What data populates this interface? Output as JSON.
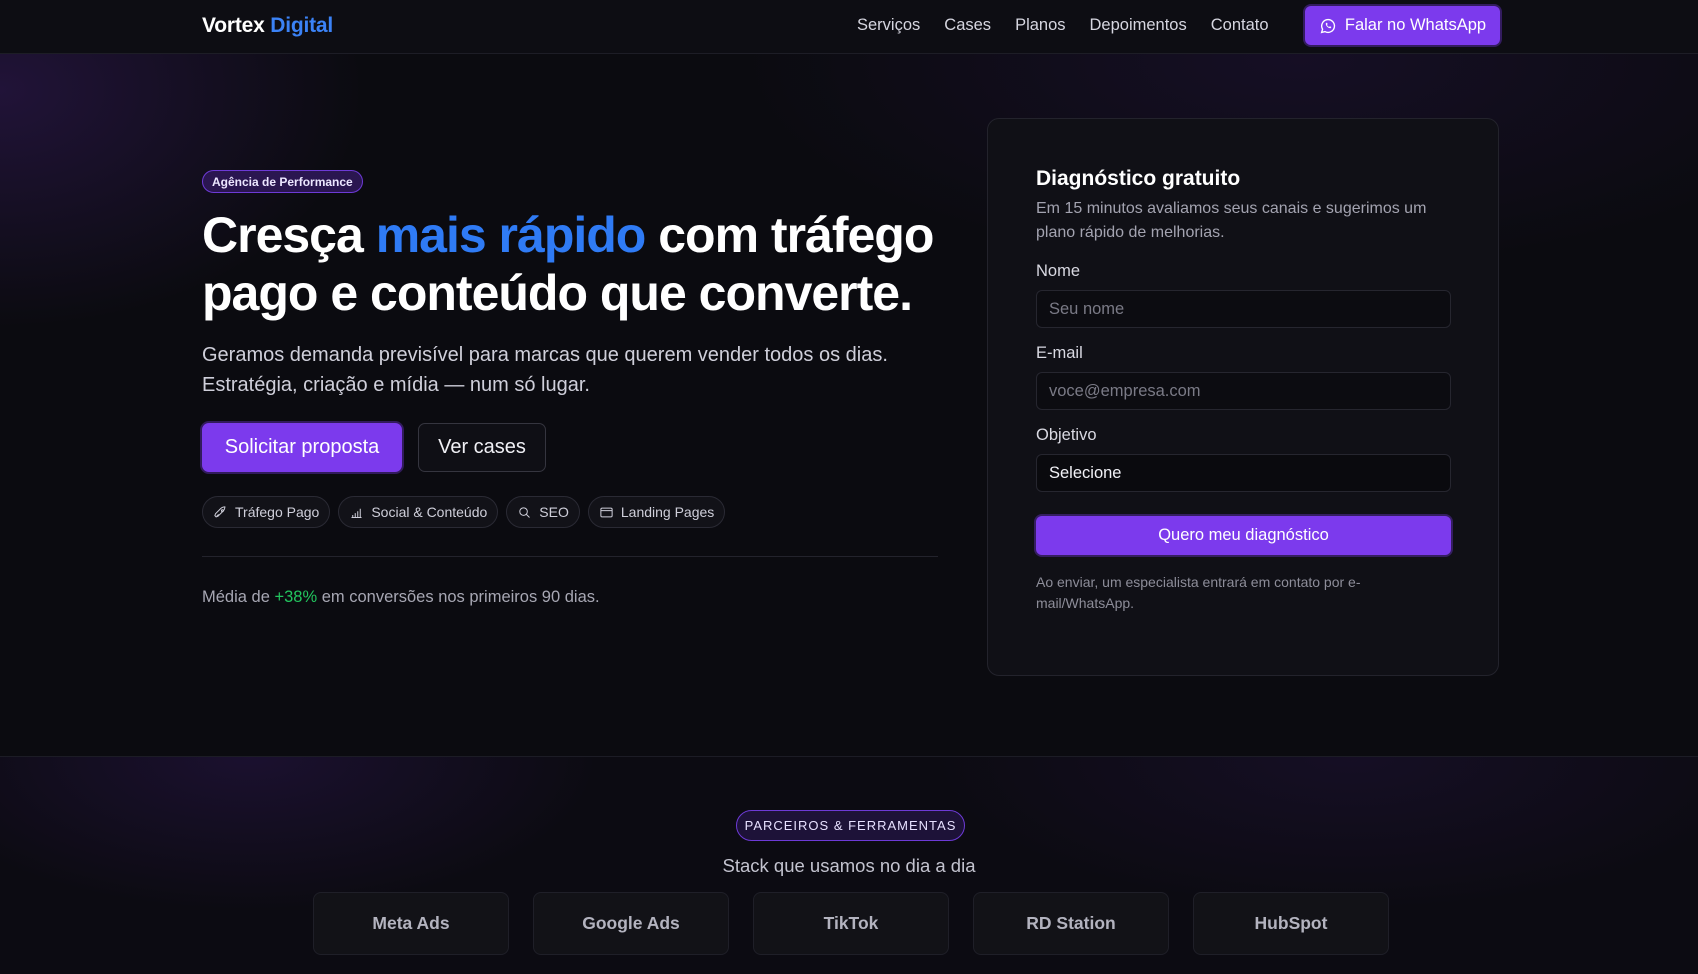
{
  "brand": {
    "name": "Vortex",
    "accent": "Digital"
  },
  "nav": {
    "links": [
      "Serviços",
      "Cases",
      "Planos",
      "Depoimentos",
      "Contato"
    ],
    "cta": "Falar no WhatsApp"
  },
  "hero": {
    "badge": "Agência de Performance",
    "headline_part1": "Cresça ",
    "headline_highlight": "mais rápido",
    "headline_part2": " com tráfego pago e conteúdo que converte.",
    "sub_line1": "Geramos demanda previsível para marcas que querem vender todos os dias.",
    "sub_line2": "Estratégia, criação e mídia — num só lugar.",
    "primary_cta": "Solicitar proposta",
    "secondary_cta": "Ver cases",
    "chips": [
      {
        "label": "Tráfego Pago",
        "icon": "rocket-icon"
      },
      {
        "label": "Social & Conteúdo",
        "icon": "bar-chart-icon"
      },
      {
        "label": "SEO",
        "icon": "search-icon"
      },
      {
        "label": "Landing Pages",
        "icon": "browser-window-icon"
      }
    ],
    "stat_prefix": "Média de ",
    "stat_value": "+38%",
    "stat_suffix": " em conversões nos primeiros 90 dias."
  },
  "form": {
    "title": "Diagnóstico gratuito",
    "description": "Em 15 minutos avaliamos seus canais e sugerimos um plano rápido de melhorias.",
    "name_label": "Nome",
    "name_placeholder": "Seu nome",
    "email_label": "E-mail",
    "email_placeholder": "voce@empresa.com",
    "goal_label": "Objetivo",
    "goal_value": "Selecione",
    "submit": "Quero meu diagnóstico",
    "note": "Ao enviar, um especialista entrará em contato por e-mail/WhatsApp."
  },
  "partners": {
    "badge": "PARCEIROS & FERRAMENTAS",
    "title": "Stack que usamos no dia a dia",
    "logos": [
      "Meta Ads",
      "Google Ads",
      "TikTok",
      "RD Station",
      "HubSpot"
    ]
  },
  "colors": {
    "accent_purple": "#7c3aed",
    "accent_blue": "#2f7bf5",
    "success_green": "#22c55e",
    "background": "#0b0b10"
  }
}
